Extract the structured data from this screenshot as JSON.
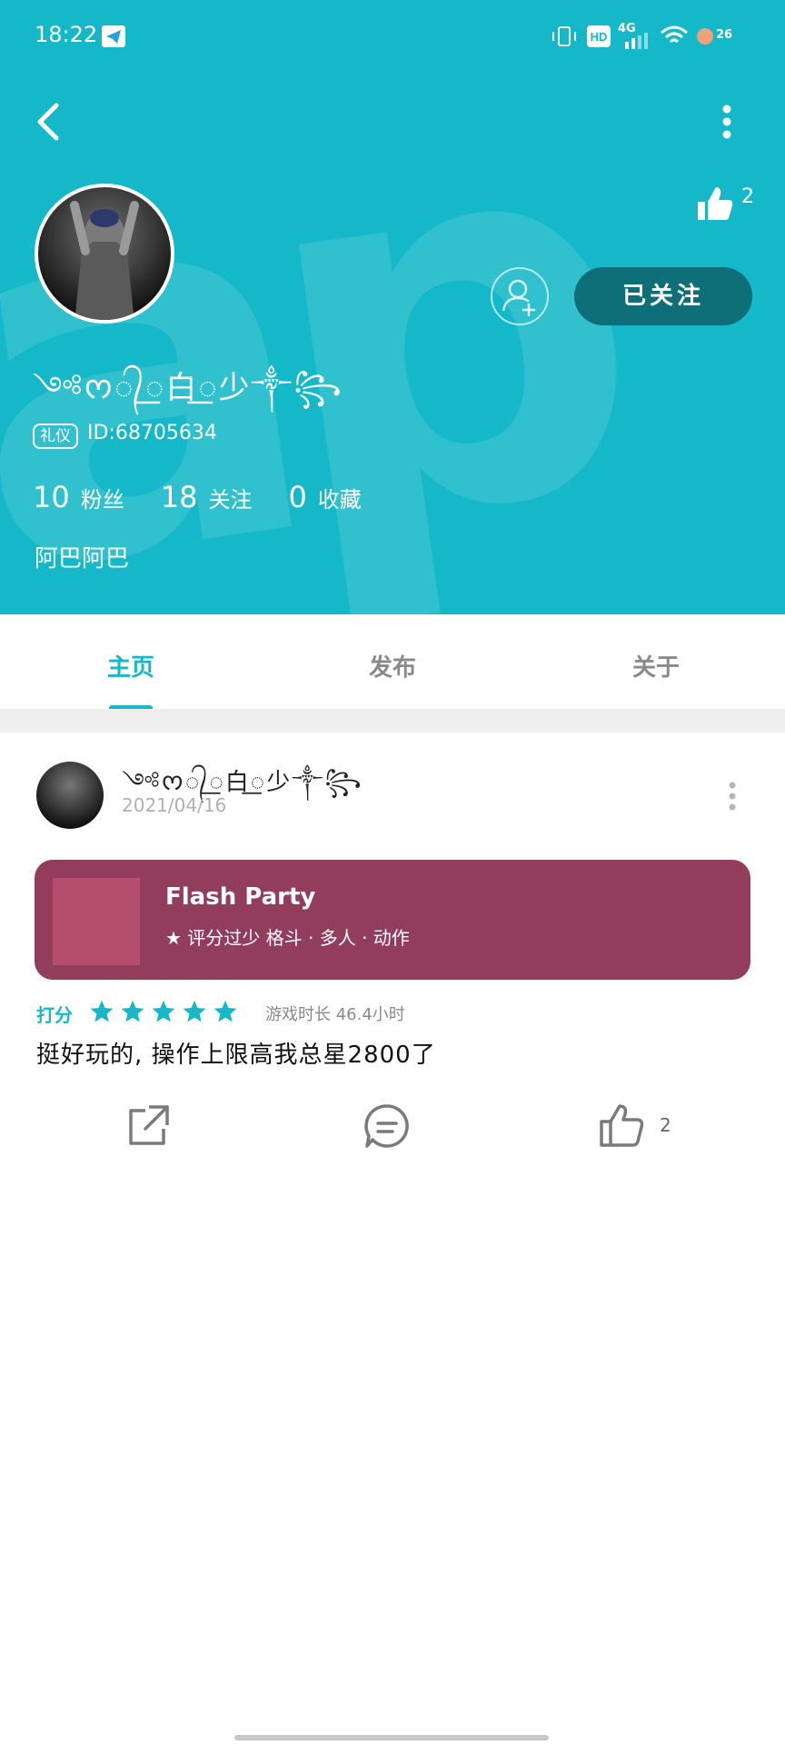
{
  "status_bar": {
    "time": "18:22",
    "network": "4G",
    "hd": "HD",
    "battery": "26",
    "icons": [
      "telegram-icon",
      "vibrate-icon",
      "hd-icon",
      "signal-icon",
      "wifi-icon",
      "battery-icon"
    ]
  },
  "profile": {
    "name": "༺ᰔ᭄꯭白꯭少༒꧂",
    "badge": "礼仪",
    "id_text": "ID:68705634",
    "stats": [
      {
        "num": "10",
        "label": "粉丝"
      },
      {
        "num": "18",
        "label": "关注"
      },
      {
        "num": "0",
        "label": "收藏"
      }
    ],
    "bio": "阿巴阿巴",
    "likes": "2",
    "follow_label": "已关注"
  },
  "tabs": [
    {
      "label": "主页",
      "active": true
    },
    {
      "label": "发布",
      "active": false
    },
    {
      "label": "关于",
      "active": false
    }
  ],
  "post": {
    "author": "༺ᰔ᭄꯭白꯭少༒꧂",
    "date": "2021/04/16",
    "game": {
      "title": "Flash Party",
      "tags": "★ 评分过少  格斗 · 多人 · 动作"
    },
    "rating_label": "打分",
    "rating_stars": 5,
    "play_time": "游戏时长 46.4小时",
    "review": "挺好玩的, 操作上限高我总星2800了",
    "like_count": "2"
  },
  "colors": {
    "accent": "#15b8c8",
    "follow_button": "#0f6f79",
    "game_card": "#923d5b",
    "game_thumb": "#b54d6e"
  }
}
